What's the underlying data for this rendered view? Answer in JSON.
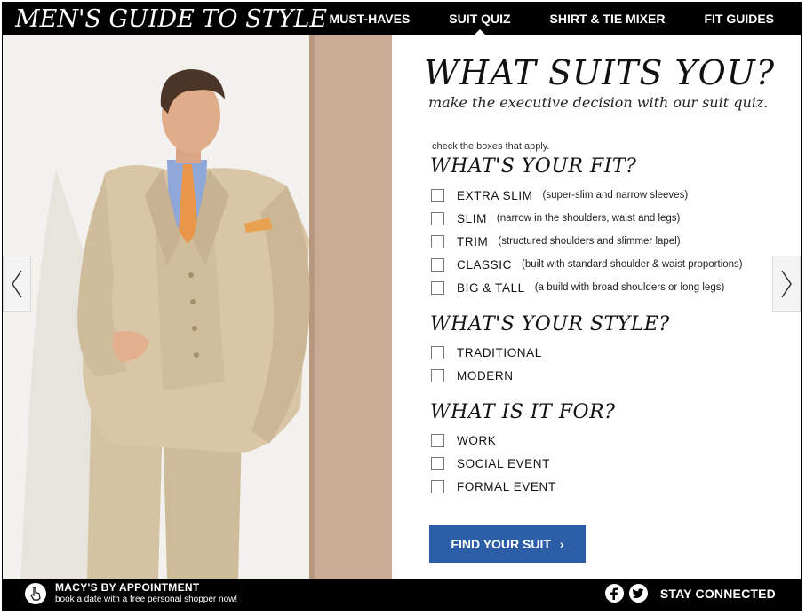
{
  "header": {
    "brand": "MEN'S GUIDE TO STYLE",
    "nav": [
      {
        "label": "MUST-HAVES",
        "active": false
      },
      {
        "label": "SUIT QUIZ",
        "active": true
      },
      {
        "label": "SHIRT & TIE MIXER",
        "active": false
      },
      {
        "label": "FIT GUIDES",
        "active": false
      }
    ]
  },
  "quiz": {
    "title": "WHAT SUITS YOU?",
    "subtitle": "make the executive decision with our suit quiz.",
    "instruction": "check the boxes that apply.",
    "fit": {
      "title": "WHAT'S YOUR FIT?",
      "options": [
        {
          "label": "EXTRA SLIM",
          "desc": "(super-slim and narrow sleeves)"
        },
        {
          "label": "SLIM",
          "desc": "(narrow in the shoulders, waist and legs)"
        },
        {
          "label": "TRIM",
          "desc": "(structured shoulders and slimmer lapel)"
        },
        {
          "label": "CLASSIC",
          "desc": "(built with standard shoulder & waist proportions)"
        },
        {
          "label": "BIG & TALL",
          "desc": "(a build with broad shoulders or long legs)"
        }
      ]
    },
    "style": {
      "title": "WHAT'S YOUR STYLE?",
      "options": [
        {
          "label": "TRADITIONAL"
        },
        {
          "label": "MODERN"
        }
      ]
    },
    "purpose": {
      "title": "WHAT IS IT FOR?",
      "options": [
        {
          "label": "WORK"
        },
        {
          "label": "SOCIAL EVENT"
        },
        {
          "label": "FORMAL EVENT"
        }
      ]
    },
    "button": "FIND YOUR SUIT",
    "button_chevron": "›"
  },
  "footer": {
    "appointment_title": "MACY'S BY APPOINTMENT",
    "appointment_link": "book a date",
    "appointment_text": " with a free personal shopper now!",
    "social_label": "STAY CONNECTED",
    "social_icons": [
      "facebook-icon",
      "twitter-icon"
    ]
  },
  "colors": {
    "bar": "#000000",
    "button": "#2c5ea8",
    "suit": "#d8c6a6",
    "wall": "#c9ab96"
  }
}
